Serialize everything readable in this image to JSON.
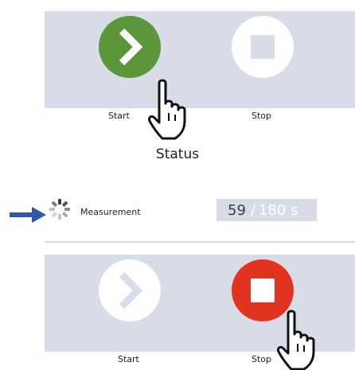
{
  "top_panel": {
    "start_label": "Start",
    "stop_label": "Stop"
  },
  "status": {
    "title": "Status",
    "measurement_label": "Measurement",
    "elapsed": "59",
    "separator": "/",
    "total": "180",
    "unit": "s"
  },
  "bottom_panel": {
    "start_label": "Start",
    "stop_label": "Stop"
  },
  "colors": {
    "panel_bg": "#d8dce9",
    "start_active": "#5c963b",
    "stop_active": "#e0341f",
    "arrow": "#2f58a8"
  },
  "icons": [
    "chevron-right-icon",
    "stop-square-icon",
    "pointer-hand-icon",
    "arrow-right-icon",
    "loading-spinner-icon"
  ]
}
